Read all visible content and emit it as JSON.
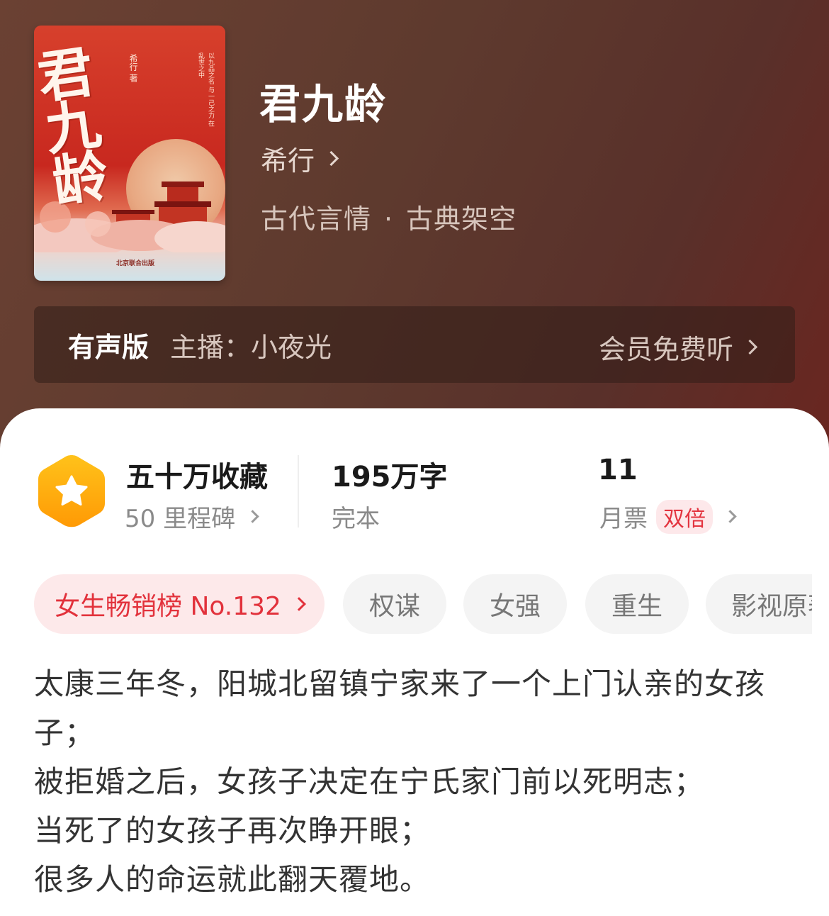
{
  "book": {
    "cover_calligraphy": "君九龄",
    "cover_author_mark": "希行 著",
    "cover_poem": "以九品之名 与一己之力 在乱世之中",
    "cover_publisher": "北京联合出版",
    "title": "君九龄",
    "author": "希行",
    "genre_primary": "古代言情",
    "genre_separator": "·",
    "genre_secondary": "古典架空"
  },
  "audio": {
    "label": "有声版",
    "host": "主播：小夜光",
    "action": "会员免费听"
  },
  "stats": {
    "collection_title": "五十万收藏",
    "collection_sub": "50 里程碑",
    "words_title": "195万字",
    "words_sub": "完本",
    "votes_title": "11",
    "votes_sub": "月票",
    "votes_badge": "双倍"
  },
  "tags": [
    "女生畅销榜 No.132",
    "权谋",
    "女强",
    "重生",
    "影视原著"
  ],
  "description": [
    "太康三年冬，阳城北留镇宁家来了一个上门认亲的女孩子；",
    "被拒婚之后，女孩子决定在宁氏家门前以死明志；",
    "当死了的女孩子再次睁开眼；",
    "很多人的命运就此翻天覆地。"
  ],
  "colors": {
    "hero_bg": "#5e3a2e",
    "accent_red": "#e2323c",
    "badge_orange": "#ffa20a"
  }
}
